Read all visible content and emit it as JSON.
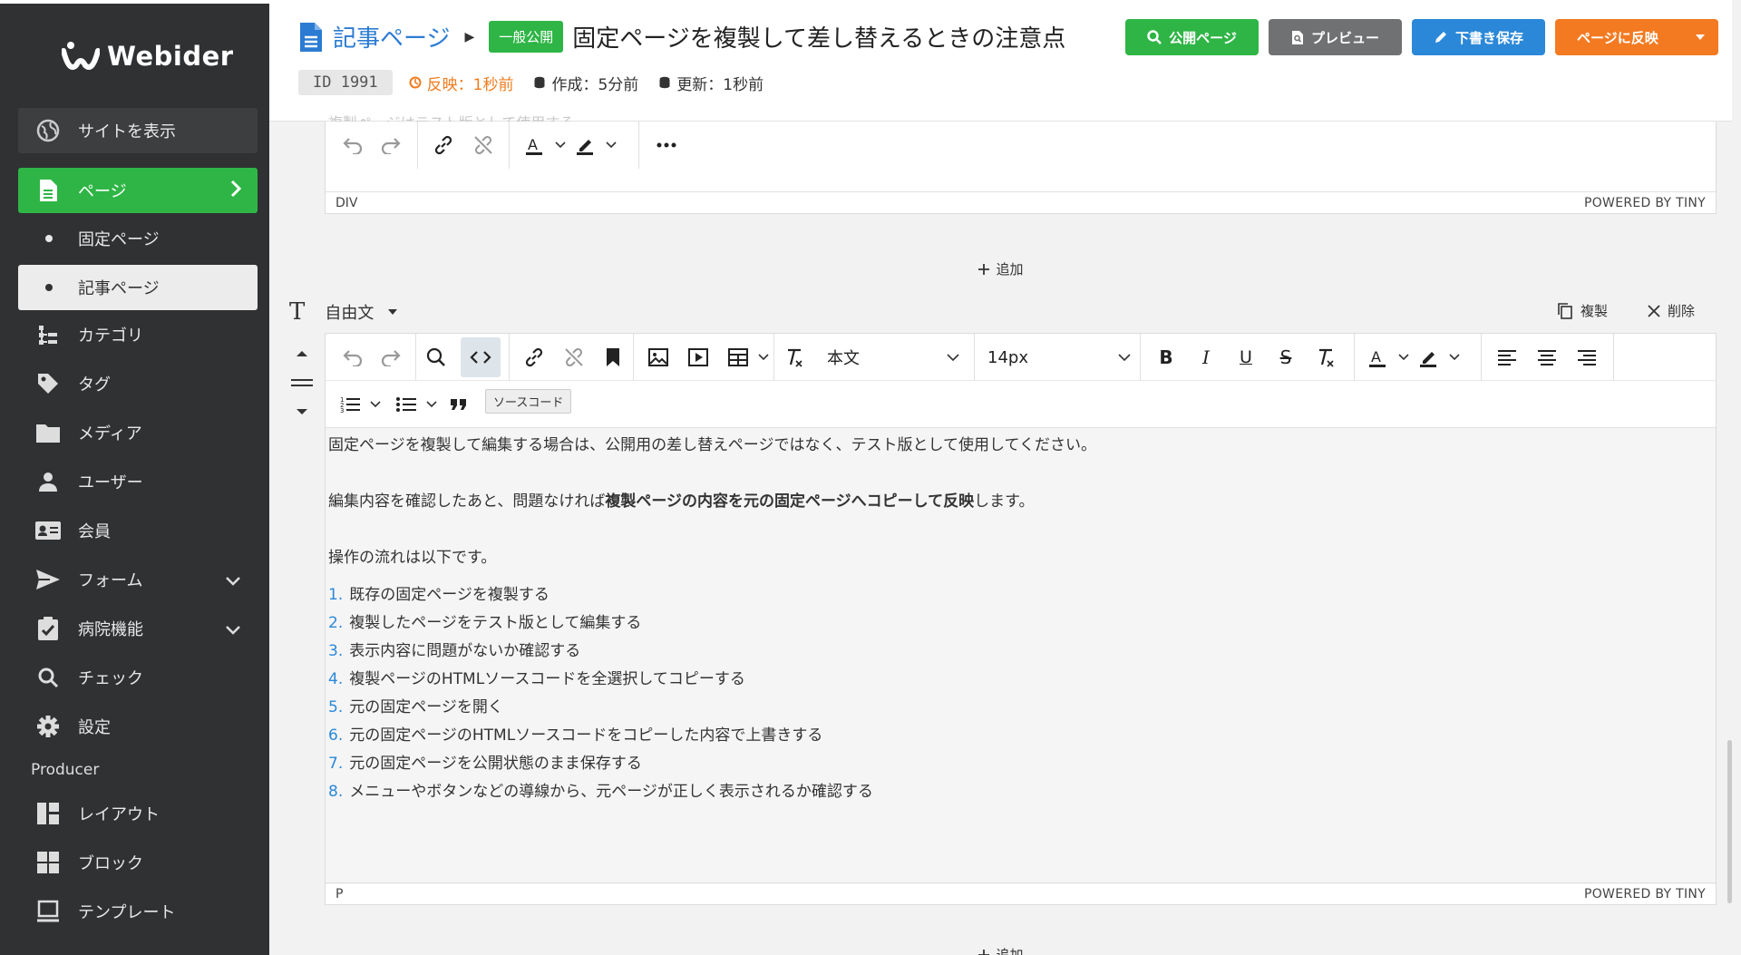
{
  "app": {
    "name": "Webider"
  },
  "sidebar": {
    "view_site": "サイトを表示",
    "items": [
      {
        "label": "ページ",
        "icon": "page-icon"
      },
      {
        "label": "固定ページ"
      },
      {
        "label": "記事ページ"
      },
      {
        "label": "カテゴリ",
        "icon": "category-icon"
      },
      {
        "label": "タグ",
        "icon": "tag-icon"
      },
      {
        "label": "メディア",
        "icon": "folder-icon"
      },
      {
        "label": "ユーザー",
        "icon": "user-icon"
      },
      {
        "label": "会員",
        "icon": "member-card-icon"
      },
      {
        "label": "フォーム",
        "icon": "send-icon"
      },
      {
        "label": "病院機能",
        "icon": "clipboard-check-icon"
      },
      {
        "label": "チェック",
        "icon": "search-icon"
      },
      {
        "label": "設定",
        "icon": "gear-icon"
      }
    ],
    "producer_label": "Producer",
    "producer_items": [
      {
        "label": "レイアウト",
        "icon": "layout-icon"
      },
      {
        "label": "ブロック",
        "icon": "blocks-icon"
      },
      {
        "label": "テンプレート",
        "icon": "monitor-icon"
      }
    ]
  },
  "header": {
    "breadcrumb": "記事ページ",
    "status_badge": "一般公開",
    "title": "固定ページを複製して差し替えるときの注意点",
    "id_label": "ID 1991",
    "reflected": "反映：1秒前",
    "created": "作成：5分前",
    "updated": "更新：1秒前",
    "buttons": {
      "public_page": "公開ページ",
      "preview": "プレビュー",
      "save_draft": "下書き保存",
      "publish": "ページに反映"
    }
  },
  "editor1": {
    "ghost_text": "複製ページはテスト版として使用する",
    "status_path": "DIV",
    "powered": "POWERED BY TINY"
  },
  "add_label": "追加",
  "block": {
    "type": "自由文",
    "duplicate": "複製",
    "delete": "削除"
  },
  "editor2": {
    "block_format": "本文",
    "font_size": "14px",
    "tooltip": "ソースコード",
    "status_path": "P",
    "powered": "POWERED BY TINY",
    "p1": "固定ページを複製して編集する場合は、公開用の差し替えページではなく、テスト版として使用してください。",
    "p2_before": "編集内容を確認したあと、問題なければ",
    "p2_bold": "複製ページの内容を元の固定ページへコピーして反映",
    "p2_after": "します。",
    "p3": "操作の流れは以下です。",
    "steps": [
      "既存の固定ページを複製する",
      "複製したページをテスト版として編集する",
      "表示内容に問題がないか確認する",
      "複製ページのHTMLソースコードを全選択してコピーする",
      "元の固定ページを開く",
      "元の固定ページのHTMLソースコードをコピーした内容で上書きする",
      "元の固定ページを公開状態のまま保存する",
      "メニューやボタンなどの導線から、元ページが正しく表示されるか確認する"
    ]
  },
  "colors": {
    "sidebar_bg": "#2f3133",
    "accent_green": "#2fb546",
    "accent_blue": "#2b88d8",
    "accent_orange": "#f37a21",
    "preview_gray": "#707173"
  }
}
